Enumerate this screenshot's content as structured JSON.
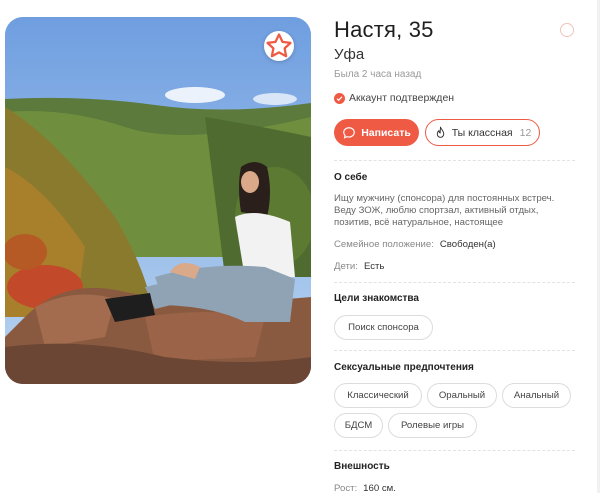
{
  "profile": {
    "name_age": "Настя, 35",
    "city": "Уфа",
    "last_seen": "Была 2 часа назад",
    "verified": "Аккаунт подтвержден"
  },
  "actions": {
    "write": "Написать",
    "like": "Ты классная",
    "like_count": "12"
  },
  "about": {
    "title": "О себе",
    "text": "Ищу мужчину (спонсора) для постоянных встреч. Веду ЗОЖ, люблю спортзал, активный отдых, позитив, всё натуральное, настоящее",
    "marital_label": "Семейное положение:",
    "marital_value": "Свободен(а)",
    "kids_label": "Дети:",
    "kids_value": "Есть"
  },
  "goals": {
    "title": "Цели знакомства",
    "items": [
      "Поиск спонсора"
    ]
  },
  "prefs": {
    "title": "Сексуальные предпочтения",
    "items": [
      "Классический",
      "Оральный",
      "Анальный",
      "БДСМ",
      "Ролевые игры"
    ]
  },
  "appearance": {
    "title": "Внешность",
    "height_label": "Рост:",
    "height_value": "160 см."
  },
  "colors": {
    "accent": "#ef5a45"
  },
  "icons": [
    "star-icon",
    "check-icon",
    "chat-icon",
    "flame-icon",
    "info-icon"
  ]
}
